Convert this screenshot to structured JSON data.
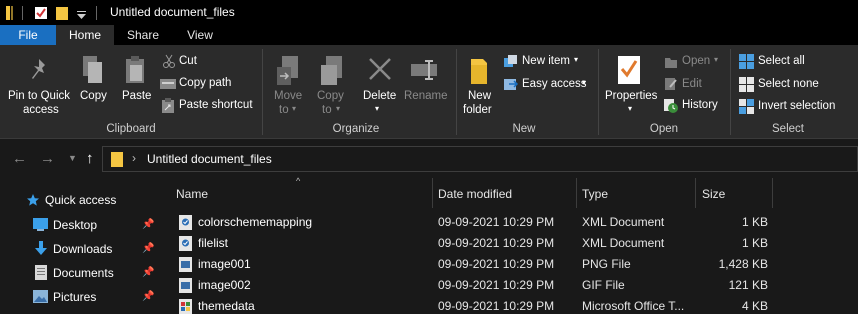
{
  "window": {
    "title": "Untitled document_files"
  },
  "tabs": [
    {
      "label": "File"
    },
    {
      "label": "Home"
    },
    {
      "label": "Share"
    },
    {
      "label": "View"
    }
  ],
  "ribbon": {
    "clipboard": {
      "label": "Clipboard",
      "pin_line1": "Pin to Quick",
      "pin_line2": "access",
      "copy": "Copy",
      "paste": "Paste",
      "cut": "Cut",
      "copy_path": "Copy path",
      "paste_shortcut": "Paste shortcut"
    },
    "organize": {
      "label": "Organize",
      "move_line1": "Move",
      "move_line2": "to",
      "copy_line1": "Copy",
      "copy_line2": "to",
      "delete": "Delete",
      "rename": "Rename"
    },
    "new": {
      "label": "New",
      "folder_line1": "New",
      "folder_line2": "folder",
      "new_item": "New item",
      "easy_access": "Easy access"
    },
    "open": {
      "label": "Open",
      "properties": "Properties",
      "open": "Open",
      "edit": "Edit",
      "history": "History"
    },
    "select": {
      "label": "Select",
      "select_all": "Select all",
      "select_none": "Select none",
      "invert_selection": "Invert selection"
    }
  },
  "address": {
    "path": "Untitled document_files"
  },
  "nav": {
    "quick_access": "Quick access",
    "items": [
      {
        "label": "Desktop"
      },
      {
        "label": "Downloads"
      },
      {
        "label": "Documents"
      },
      {
        "label": "Pictures"
      }
    ]
  },
  "columns": {
    "name": "Name",
    "date_modified": "Date modified",
    "type": "Type",
    "size": "Size"
  },
  "files": [
    {
      "name": "colorschememapping",
      "date": "09-09-2021 10:29 PM",
      "type": "XML Document",
      "size": "1 KB",
      "icon": "xml-file-icon"
    },
    {
      "name": "filelist",
      "date": "09-09-2021 10:29 PM",
      "type": "XML Document",
      "size": "1 KB",
      "icon": "xml-file-icon"
    },
    {
      "name": "image001",
      "date": "09-09-2021 10:29 PM",
      "type": "PNG File",
      "size": "1,428 KB",
      "icon": "image-file-icon"
    },
    {
      "name": "image002",
      "date": "09-09-2021 10:29 PM",
      "type": "GIF File",
      "size": "121 KB",
      "icon": "image-file-icon"
    },
    {
      "name": "themedata",
      "date": "09-09-2021 10:29 PM",
      "type": "Microsoft Office T...",
      "size": "4 KB",
      "icon": "office-theme-file-icon"
    }
  ],
  "colors": {
    "accent": "#1a6fc1",
    "folder": "#f4c542",
    "background": "#191919",
    "ribbon": "#2b2b2b"
  }
}
